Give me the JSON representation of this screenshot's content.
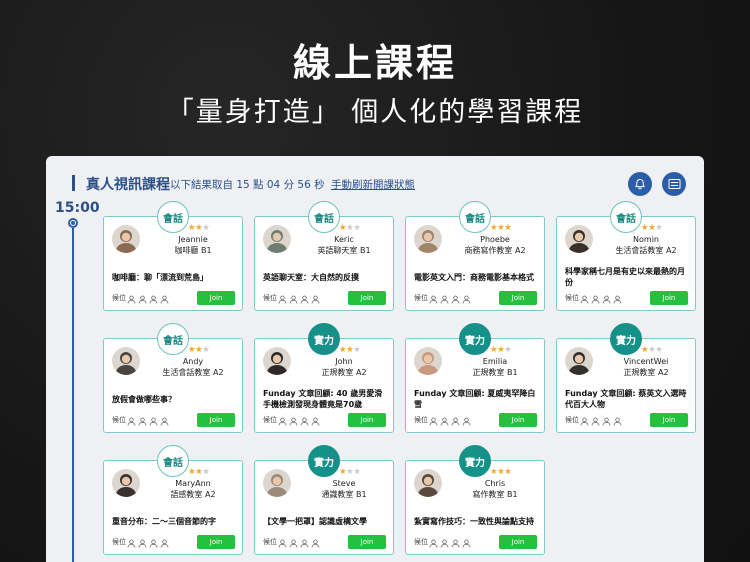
{
  "hero": {
    "title": "線上課程",
    "subtitle": "「量身打造」 個人化的學習課程"
  },
  "panel": {
    "title": "真人視訊課程",
    "note": "以下結果取自 15 點 04 分 56 秒",
    "refresh_link": "手動刷新開課狀態",
    "bell_icon": "bell-icon",
    "list_icon": "list-icon"
  },
  "timeline": {
    "time": "15:00"
  },
  "labels": {
    "seat": "候位",
    "join": "Join"
  },
  "colors": {
    "accent": "#2c4f86",
    "join": "#23c13e",
    "badge_dark": "#16918a",
    "star": "#f1a626"
  },
  "courses": [
    {
      "badge": "會話",
      "badge_style": "light",
      "teacher": "Jeannie",
      "room": "咖啡廳 B1",
      "stars": 2,
      "topic": "咖啡廳：聊「漂流到荒島」",
      "avatar": "#8b6a52"
    },
    {
      "badge": "會話",
      "badge_style": "light",
      "teacher": "Keric",
      "room": "英語聊天室 B1",
      "stars": 1,
      "topic": "英語聊天室：大自然的反撲",
      "avatar": "#6f7d73"
    },
    {
      "badge": "會話",
      "badge_style": "light",
      "teacher": "Phoebe",
      "room": "商務寫作教室 A2",
      "stars": 3,
      "topic": "電影英文入門：商務電影基本格式",
      "avatar": "#a0856b"
    },
    {
      "badge": "會話",
      "badge_style": "light",
      "teacher": "Nomin",
      "room": "生活會話教室 A2",
      "stars": 2,
      "topic": "科學家稱七月是有史以來最熱的月份",
      "avatar": "#3b2f2a"
    },
    {
      "badge": "會話",
      "badge_style": "light",
      "teacher": "Andy",
      "room": "生活會話教室 A2",
      "stars": 2,
      "topic": "放假會做哪些事？",
      "avatar": "#4a4440"
    },
    {
      "badge": "實力",
      "badge_style": "dark",
      "teacher": "John",
      "room": "正規教室 A2",
      "stars": 2,
      "topic": "Funday 文章回顧: 40 歲男愛滑手機檢測發現身體竟是70歲",
      "avatar": "#2f2a27"
    },
    {
      "badge": "實力",
      "badge_style": "dark",
      "teacher": "Emilia",
      "room": "正規教室 B1",
      "stars": 2,
      "topic": "Funday 文章回顧: 夏威夷罕降白雪",
      "avatar": "#c79a7f"
    },
    {
      "badge": "實力",
      "badge_style": "dark",
      "teacher": "VincentWei",
      "room": "正規教室 A2",
      "stars": 1,
      "topic": "Funday 文章回顧: 蔡英文入選時代百大人物",
      "avatar": "#33302d"
    },
    {
      "badge": "會話",
      "badge_style": "light",
      "teacher": "MaryAnn",
      "room": "語感教室 A2",
      "stars": 2,
      "topic": "重音分布：二～三個音節的字",
      "avatar": "#3a302c"
    },
    {
      "badge": "實力",
      "badge_style": "dark",
      "teacher": "Steve",
      "room": "通識教室 B1",
      "stars": 1,
      "topic": "【文學一把罩】認識虛構文學",
      "avatar": "#9a8b7a"
    },
    {
      "badge": "實力",
      "badge_style": "dark",
      "teacher": "Chris",
      "room": "寫作教室 B1",
      "stars": 3,
      "topic": "紮實寫作技巧：一致性與論點支持",
      "avatar": "#5a4a3e"
    }
  ]
}
